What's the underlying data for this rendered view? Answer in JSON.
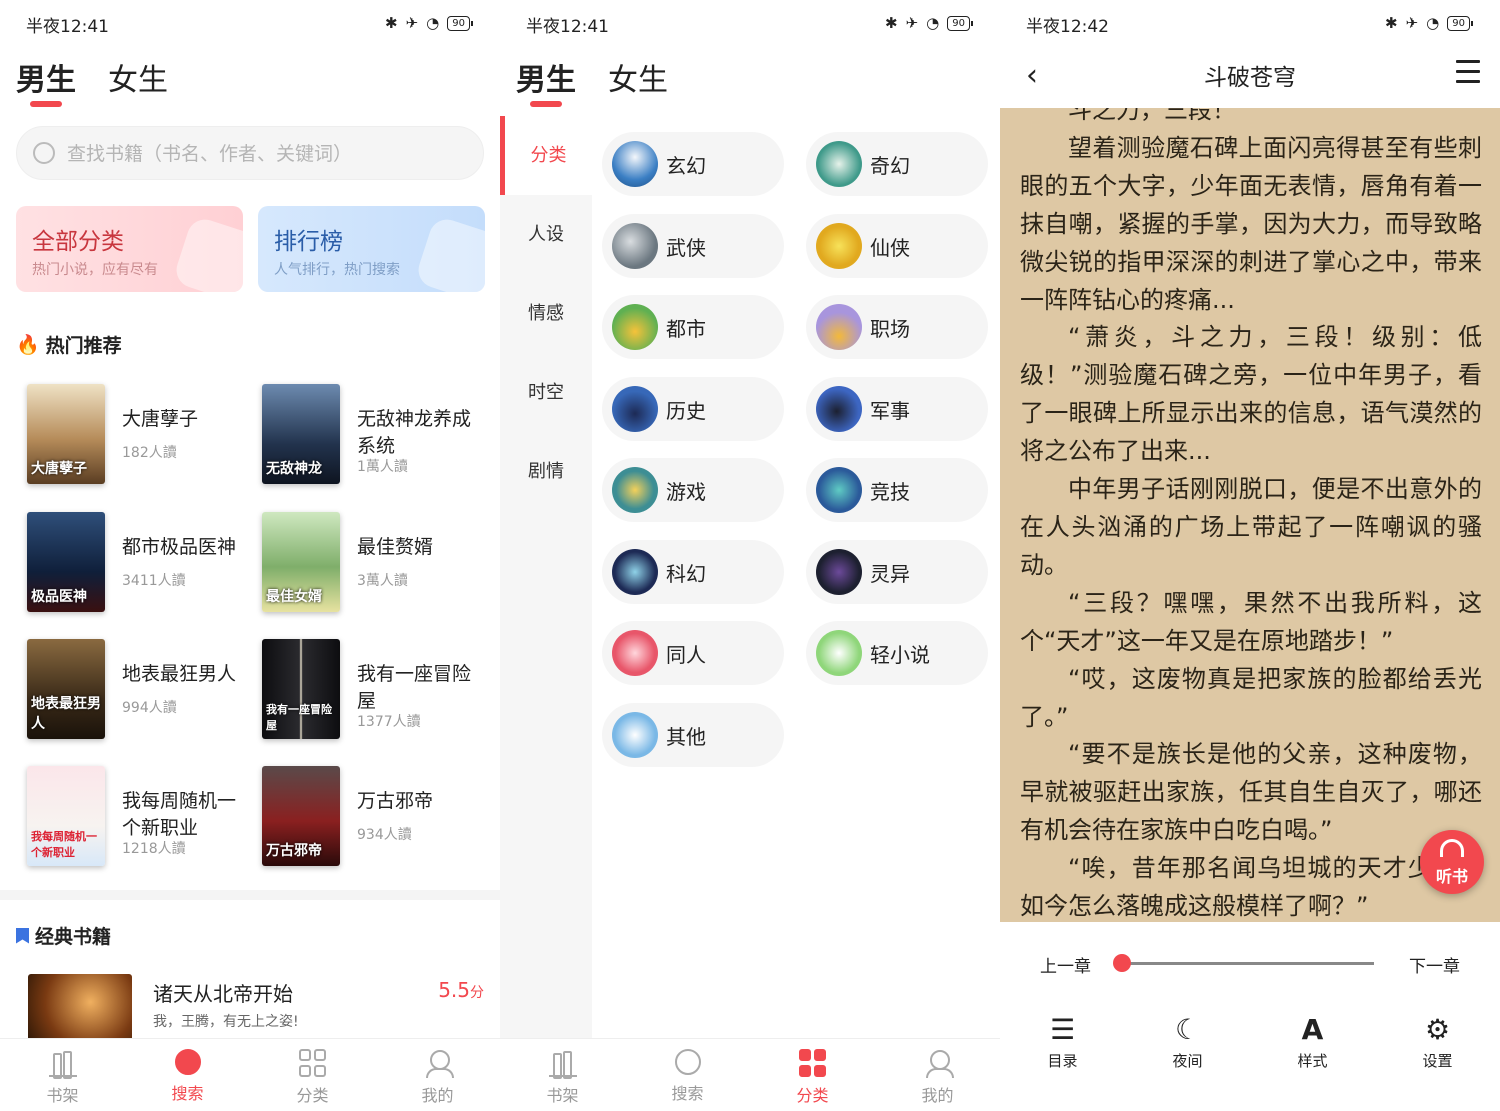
{
  "colors": {
    "accent": "#f2484e",
    "paper": "#dec8a4"
  },
  "status_bars": [
    {
      "time": "半夜12:41",
      "battery": "90"
    },
    {
      "time": "半夜12:41",
      "battery": "90"
    },
    {
      "time": "半夜12:42",
      "battery": "90"
    }
  ],
  "gender_tabs": [
    "男生",
    "女生"
  ],
  "search": {
    "placeholder": "查找书籍（书名、作者、关键词）"
  },
  "cards": [
    {
      "title": "全部分类",
      "subtitle": "热门小说，应有尽有"
    },
    {
      "title": "排行榜",
      "subtitle": "人气排行，热门搜索"
    }
  ],
  "hot": {
    "title": "热门推荐",
    "books": [
      {
        "name": "大唐孽子",
        "reads": "182人讀",
        "cover_text": "大唐孽子"
      },
      {
        "name": "无敌神龙养成系统",
        "reads": "1萬人讀",
        "cover_text": "无敌神龙"
      },
      {
        "name": "都市极品医神",
        "reads": "3411人讀",
        "cover_text": "极品医神"
      },
      {
        "name": "最佳赘婿",
        "reads": "3萬人讀",
        "cover_text": "最佳女婿"
      },
      {
        "name": "地表最狂男人",
        "reads": "994人讀",
        "cover_text": "地表最狂男人"
      },
      {
        "name": "我有一座冒险屋",
        "reads": "1377人讀",
        "cover_text": "我有一座冒险屋"
      },
      {
        "name": "我每周随机一个新职业",
        "reads": "1218人讀",
        "cover_text": "我每周随机一个新职业"
      },
      {
        "name": "万古邪帝",
        "reads": "934人讀",
        "cover_text": "万古邪帝"
      }
    ]
  },
  "classic": {
    "title": "经典书籍",
    "book": {
      "name": "诸天从北帝开始",
      "desc": "我，王腾，有无上之姿!",
      "score": "5.5",
      "score_unit": "分"
    }
  },
  "bottom_nav": [
    "书架",
    "搜索",
    "分类",
    "我的"
  ],
  "side_menu": [
    "分类",
    "人设",
    "情感",
    "时空",
    "剧情"
  ],
  "categories": [
    "玄幻",
    "奇幻",
    "武侠",
    "仙侠",
    "都市",
    "职场",
    "历史",
    "军事",
    "游戏",
    "竞技",
    "科幻",
    "灵异",
    "同人",
    "轻小说",
    "其他"
  ],
  "reader": {
    "title": "斗破苍穹",
    "paragraphs": [
      "斗之力，三段！",
      "望着测验魔石碑上面闪亮得甚至有些刺眼的五个大字，少年面无表情，唇角有着一抹自嘲，紧握的手掌，因为大力，而导致略微尖锐的指甲深深的刺进了掌心之中，带来一阵阵钻心的疼痛...",
      "“萧炎，斗之力，三段！级别：低级！”测验魔石碑之旁，一位中年男子，看了一眼碑上所显示出来的信息，语气漠然的将之公布了出来...",
      "中年男子话刚刚脱口，便是不出意外的在人头汹涌的广场上带起了一阵嘲讽的骚动。",
      "“三段？嘿嘿，果然不出我所料，这个“天才”这一年又是在原地踏步！”",
      "“哎，这废物真是把家族的脸都给丢光了。”",
      "“要不是族长是他的父亲，这种废物，早就被驱赶出家族，任其自生自灭了，哪还有机会待在家族中白吃白喝。”",
      "“唉，昔年那名闻乌坦城的天才少年，如今怎么落魄成这般模样了啊？”"
    ],
    "listen_label": "听书",
    "prev_chapter": "上一章",
    "next_chapter": "下一章",
    "progress": 0.0,
    "tools": [
      "目录",
      "夜间",
      "样式",
      "设置"
    ]
  }
}
